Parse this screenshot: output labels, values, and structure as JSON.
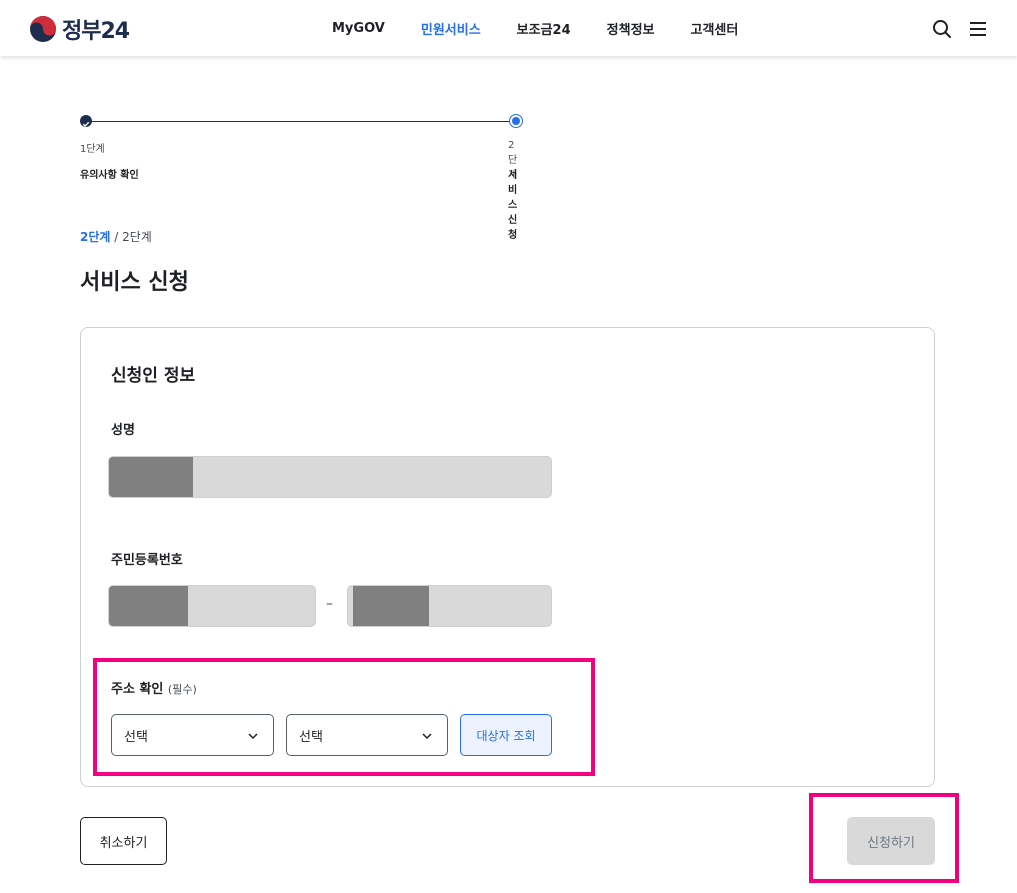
{
  "header": {
    "logo_text": "정부24",
    "nav": [
      "MyGOV",
      "민원서비스",
      "보조금24",
      "정책정보",
      "고객센터"
    ],
    "active_nav": 1,
    "icons": [
      "search-icon",
      "menu-icon"
    ]
  },
  "stepper": {
    "steps": [
      {
        "num": "1단계",
        "label": "유의사항 확인"
      },
      {
        "num": "2단계",
        "label": "서비스 신청"
      }
    ]
  },
  "breadcrumb": {
    "current": "2단계",
    "separator": " / ",
    "total": "2단계"
  },
  "page_title": "서비스 신청",
  "card": {
    "title": "신청인 정보",
    "name_label": "성명",
    "rrn_label": "주민등록번호",
    "rrn_dash": "–",
    "address_label": "주소 확인",
    "address_required": "(필수)",
    "select1": "선택",
    "select2": "선택",
    "lookup_button": "대상자 조회"
  },
  "buttons": {
    "cancel": "취소하기",
    "submit": "신청하기"
  },
  "colors": {
    "accent": "#256ef4",
    "navy": "#1d2c4f",
    "highlight": "#f2007f",
    "disabled": "#d9d9d9",
    "mask": "#808080"
  }
}
